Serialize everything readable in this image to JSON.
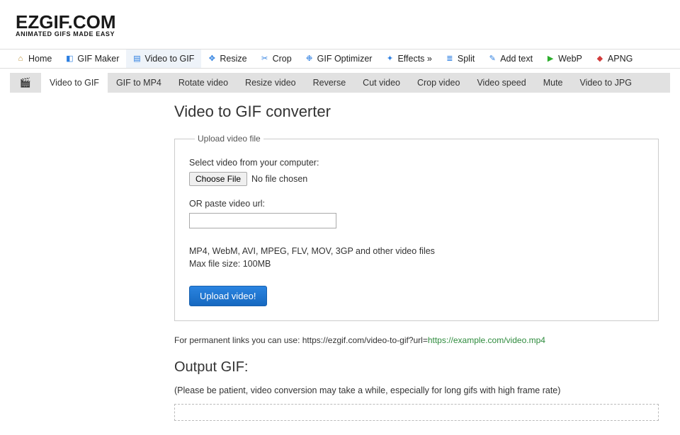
{
  "logo": {
    "main": "EZGIF.COM",
    "sub": "ANIMATED GIFS MADE EASY"
  },
  "nav_primary": [
    {
      "label": "Home",
      "icon": "home"
    },
    {
      "label": "GIF Maker",
      "icon": "make"
    },
    {
      "label": "Video to GIF",
      "icon": "vid",
      "active": true
    },
    {
      "label": "Resize",
      "icon": "resize"
    },
    {
      "label": "Crop",
      "icon": "crop"
    },
    {
      "label": "GIF Optimizer",
      "icon": "opt"
    },
    {
      "label": "Effects »",
      "icon": "fx"
    },
    {
      "label": "Split",
      "icon": "split"
    },
    {
      "label": "Add text",
      "icon": "text"
    },
    {
      "label": "WebP",
      "icon": "webp"
    },
    {
      "label": "APNG",
      "icon": "apng"
    }
  ],
  "nav_sub": [
    {
      "label": "Video to GIF",
      "active": true
    },
    {
      "label": "GIF to MP4"
    },
    {
      "label": "Rotate video"
    },
    {
      "label": "Resize video"
    },
    {
      "label": "Reverse"
    },
    {
      "label": "Cut video"
    },
    {
      "label": "Crop video"
    },
    {
      "label": "Video speed"
    },
    {
      "label": "Mute"
    },
    {
      "label": "Video to JPG"
    }
  ],
  "page": {
    "title": "Video to GIF converter",
    "legend": "Upload video file",
    "select_label": "Select video from your computer:",
    "choose_file": "Choose File",
    "no_file": "No file chosen",
    "or_paste": "OR paste video url:",
    "url_value": "",
    "formats": "MP4, WebM, AVI, MPEG, FLV, MOV, 3GP and other video files",
    "max_size": "Max file size: 100MB",
    "upload_btn": "Upload video!",
    "permalink_prefix": "For permanent links you can use: https://ezgif.com/video-to-gif?url=",
    "permalink_example": "https://example.com/video.mp4",
    "output_heading": "Output GIF:",
    "patient": "(Please be patient, video conversion may take a while, especially for long gifs with high frame rate)"
  }
}
